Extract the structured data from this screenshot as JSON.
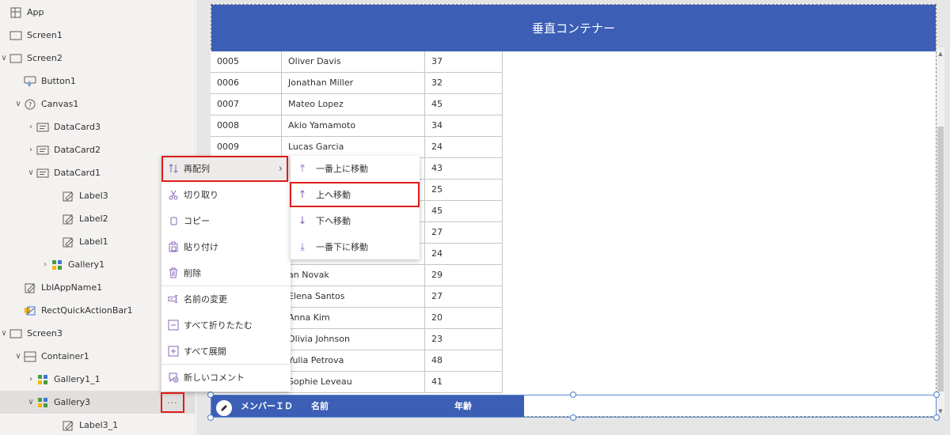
{
  "tree": {
    "items": [
      {
        "label": "App",
        "icon": "app-icon",
        "chevron": ""
      },
      {
        "label": "Screen1",
        "icon": "screen-icon",
        "chevron": ""
      },
      {
        "label": "Screen2",
        "icon": "screen-icon",
        "chevron": "∨"
      },
      {
        "label": "Button1",
        "icon": "button-icon",
        "chevron": ""
      },
      {
        "label": "Canvas1",
        "icon": "canvas-icon",
        "chevron": "∨"
      },
      {
        "label": "DataCard3",
        "icon": "datacard-icon",
        "chevron": "›"
      },
      {
        "label": "DataCard2",
        "icon": "datacard-icon",
        "chevron": "›"
      },
      {
        "label": "DataCard1",
        "icon": "datacard-icon",
        "chevron": "∨"
      },
      {
        "label": "Label3",
        "icon": "label-icon",
        "chevron": ""
      },
      {
        "label": "Label2",
        "icon": "label-icon",
        "chevron": ""
      },
      {
        "label": "Label1",
        "icon": "label-icon",
        "chevron": ""
      },
      {
        "label": "Gallery1",
        "icon": "gallery-icon",
        "chevron": "›"
      },
      {
        "label": "LblAppName1",
        "icon": "label-icon",
        "chevron": ""
      },
      {
        "label": "RectQuickActionBar1",
        "icon": "rectangle-icon",
        "chevron": ""
      },
      {
        "label": "Screen3",
        "icon": "screen-icon",
        "chevron": "∨"
      },
      {
        "label": "Container1",
        "icon": "container-icon",
        "chevron": "∨"
      },
      {
        "label": "Gallery1_1",
        "icon": "gallery-icon",
        "chevron": "›"
      },
      {
        "label": "Gallery3",
        "icon": "gallery-icon",
        "chevron": "∨"
      },
      {
        "label": "Label3_1",
        "icon": "label-icon",
        "chevron": ""
      }
    ],
    "more_button": "···"
  },
  "container": {
    "title": "垂直コンテナー"
  },
  "grid": {
    "rows": [
      {
        "id": "0005",
        "name": "Oliver Davis",
        "age": "37"
      },
      {
        "id": "0006",
        "name": "Jonathan Miller",
        "age": "32"
      },
      {
        "id": "0007",
        "name": "Mateo Lopez",
        "age": "45"
      },
      {
        "id": "0008",
        "name": "Akio Yamamoto",
        "age": "34"
      },
      {
        "id": "0009",
        "name": "Lucas Garcia",
        "age": "24"
      },
      {
        "id": "",
        "name": "",
        "age": "43"
      },
      {
        "id": "",
        "name": "",
        "age": "25"
      },
      {
        "id": "",
        "name": "",
        "age": "45"
      },
      {
        "id": "",
        "name": "",
        "age": "27"
      },
      {
        "id": "",
        "name": "",
        "age": "24"
      },
      {
        "id": "",
        "name": "an Novak",
        "age": "29"
      },
      {
        "id": "",
        "name": "Elena Santos",
        "age": "27"
      },
      {
        "id": "",
        "name": "Anna Kim",
        "age": "20"
      },
      {
        "id": "",
        "name": "Olivia Johnson",
        "age": "23"
      },
      {
        "id": "",
        "name": "Yulia Petrova",
        "age": "48"
      },
      {
        "id": "",
        "name": "Sophie Leveau",
        "age": "41"
      }
    ]
  },
  "gallery_header": {
    "id_label": "メンバーＩＤ",
    "name_label": "名前",
    "age_label": "年齢"
  },
  "context_menu": {
    "items": [
      {
        "label": "再配列",
        "icon": "reorder-icon",
        "submenu_arrow": "›"
      },
      {
        "label": "切り取り",
        "icon": "cut-icon"
      },
      {
        "label": "コピー",
        "icon": "copy-icon"
      },
      {
        "label": "貼り付け",
        "icon": "paste-icon"
      },
      {
        "label": "削除",
        "icon": "delete-icon"
      },
      {
        "label": "名前の変更",
        "icon": "rename-icon"
      },
      {
        "label": "すべて折りたたむ",
        "icon": "collapse-all-icon"
      },
      {
        "label": "すべて展開",
        "icon": "expand-all-icon"
      },
      {
        "label": "新しいコメント",
        "icon": "new-comment-icon"
      }
    ]
  },
  "submenu": {
    "items": [
      {
        "label": "一番上に移動",
        "icon": "move-to-top-icon",
        "glyph": "⤒"
      },
      {
        "label": "上へ移動",
        "icon": "move-up-icon",
        "glyph": "↑"
      },
      {
        "label": "下へ移動",
        "icon": "move-down-icon",
        "glyph": "↓"
      },
      {
        "label": "一番下に移動",
        "icon": "move-to-bottom-icon",
        "glyph": "⤓"
      }
    ]
  },
  "colors": {
    "accent": "#3c5fb5",
    "highlight": "#e01b1b",
    "icon_purple": "#8764b8"
  }
}
